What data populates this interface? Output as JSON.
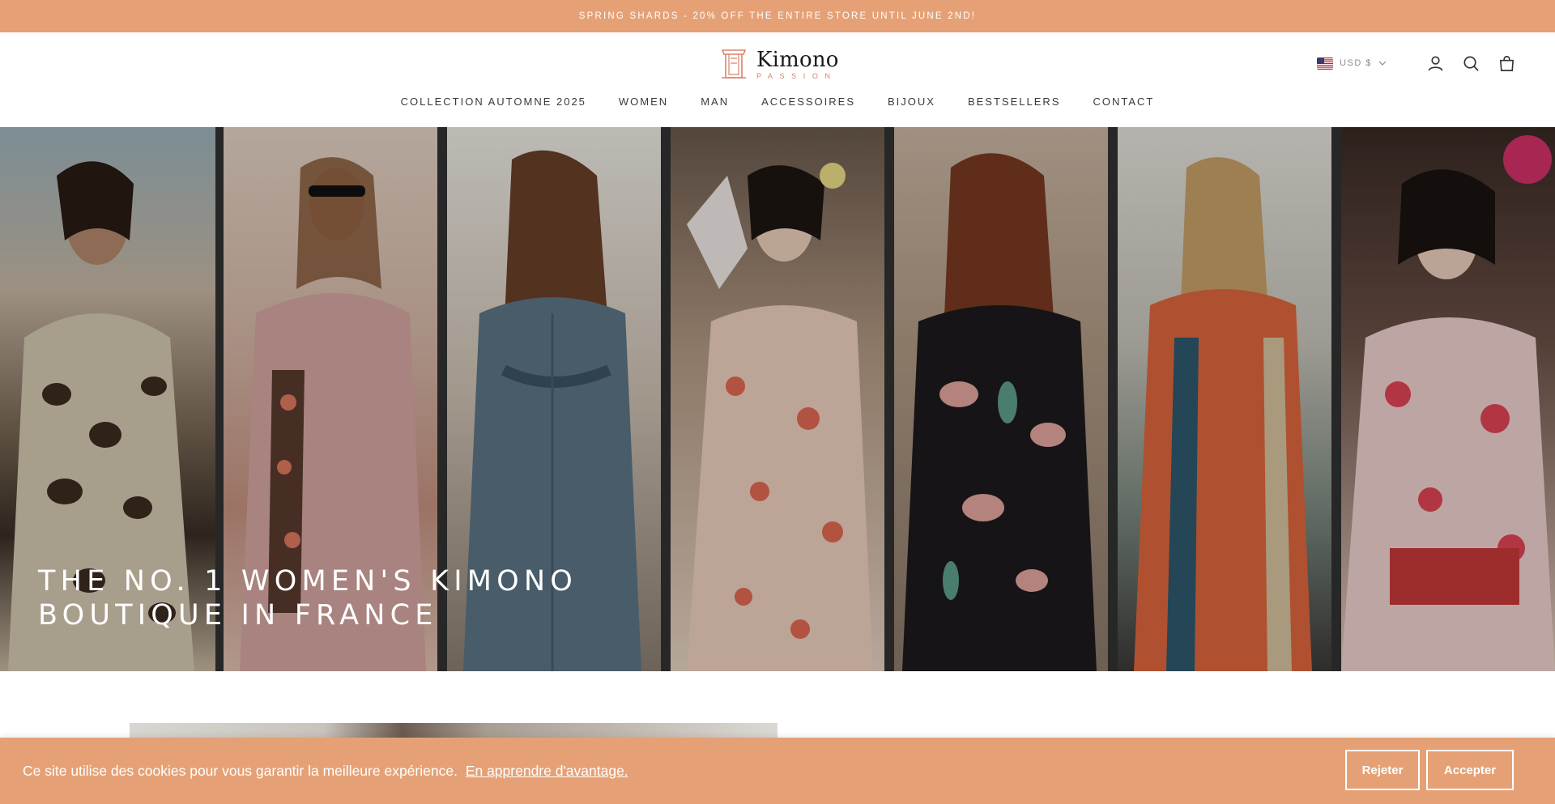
{
  "announcement": {
    "text": "SPRING SHARDS - 20% OFF THE ENTIRE STORE UNTIL JUNE 2ND!"
  },
  "brand": {
    "name": "Kimono",
    "tagline": "PASSION",
    "accent_color": "#e5a175"
  },
  "header": {
    "currency": {
      "label": "USD $",
      "flag": "us-flag-icon"
    },
    "icons": [
      "account-icon",
      "search-icon",
      "cart-icon"
    ]
  },
  "nav": {
    "items": [
      {
        "label": "COLLECTION AUTOMNE 2025"
      },
      {
        "label": "WOMEN"
      },
      {
        "label": "MAN"
      },
      {
        "label": "ACCESSOIRES"
      },
      {
        "label": "BIJOUX"
      },
      {
        "label": "BESTSELLERS"
      },
      {
        "label": "CONTACT"
      }
    ]
  },
  "hero": {
    "title_line1": "THE NO. 1 WOMEN'S KIMONO",
    "title_line2": "BOUTIQUE IN FRANCE"
  },
  "cookie_banner": {
    "message": "Ce site utilise des cookies pour vous garantir la meilleure expérience.",
    "learn_more": "En apprendre d'avantage.",
    "reject_label": "Rejeter",
    "accept_label": "Accepter"
  }
}
